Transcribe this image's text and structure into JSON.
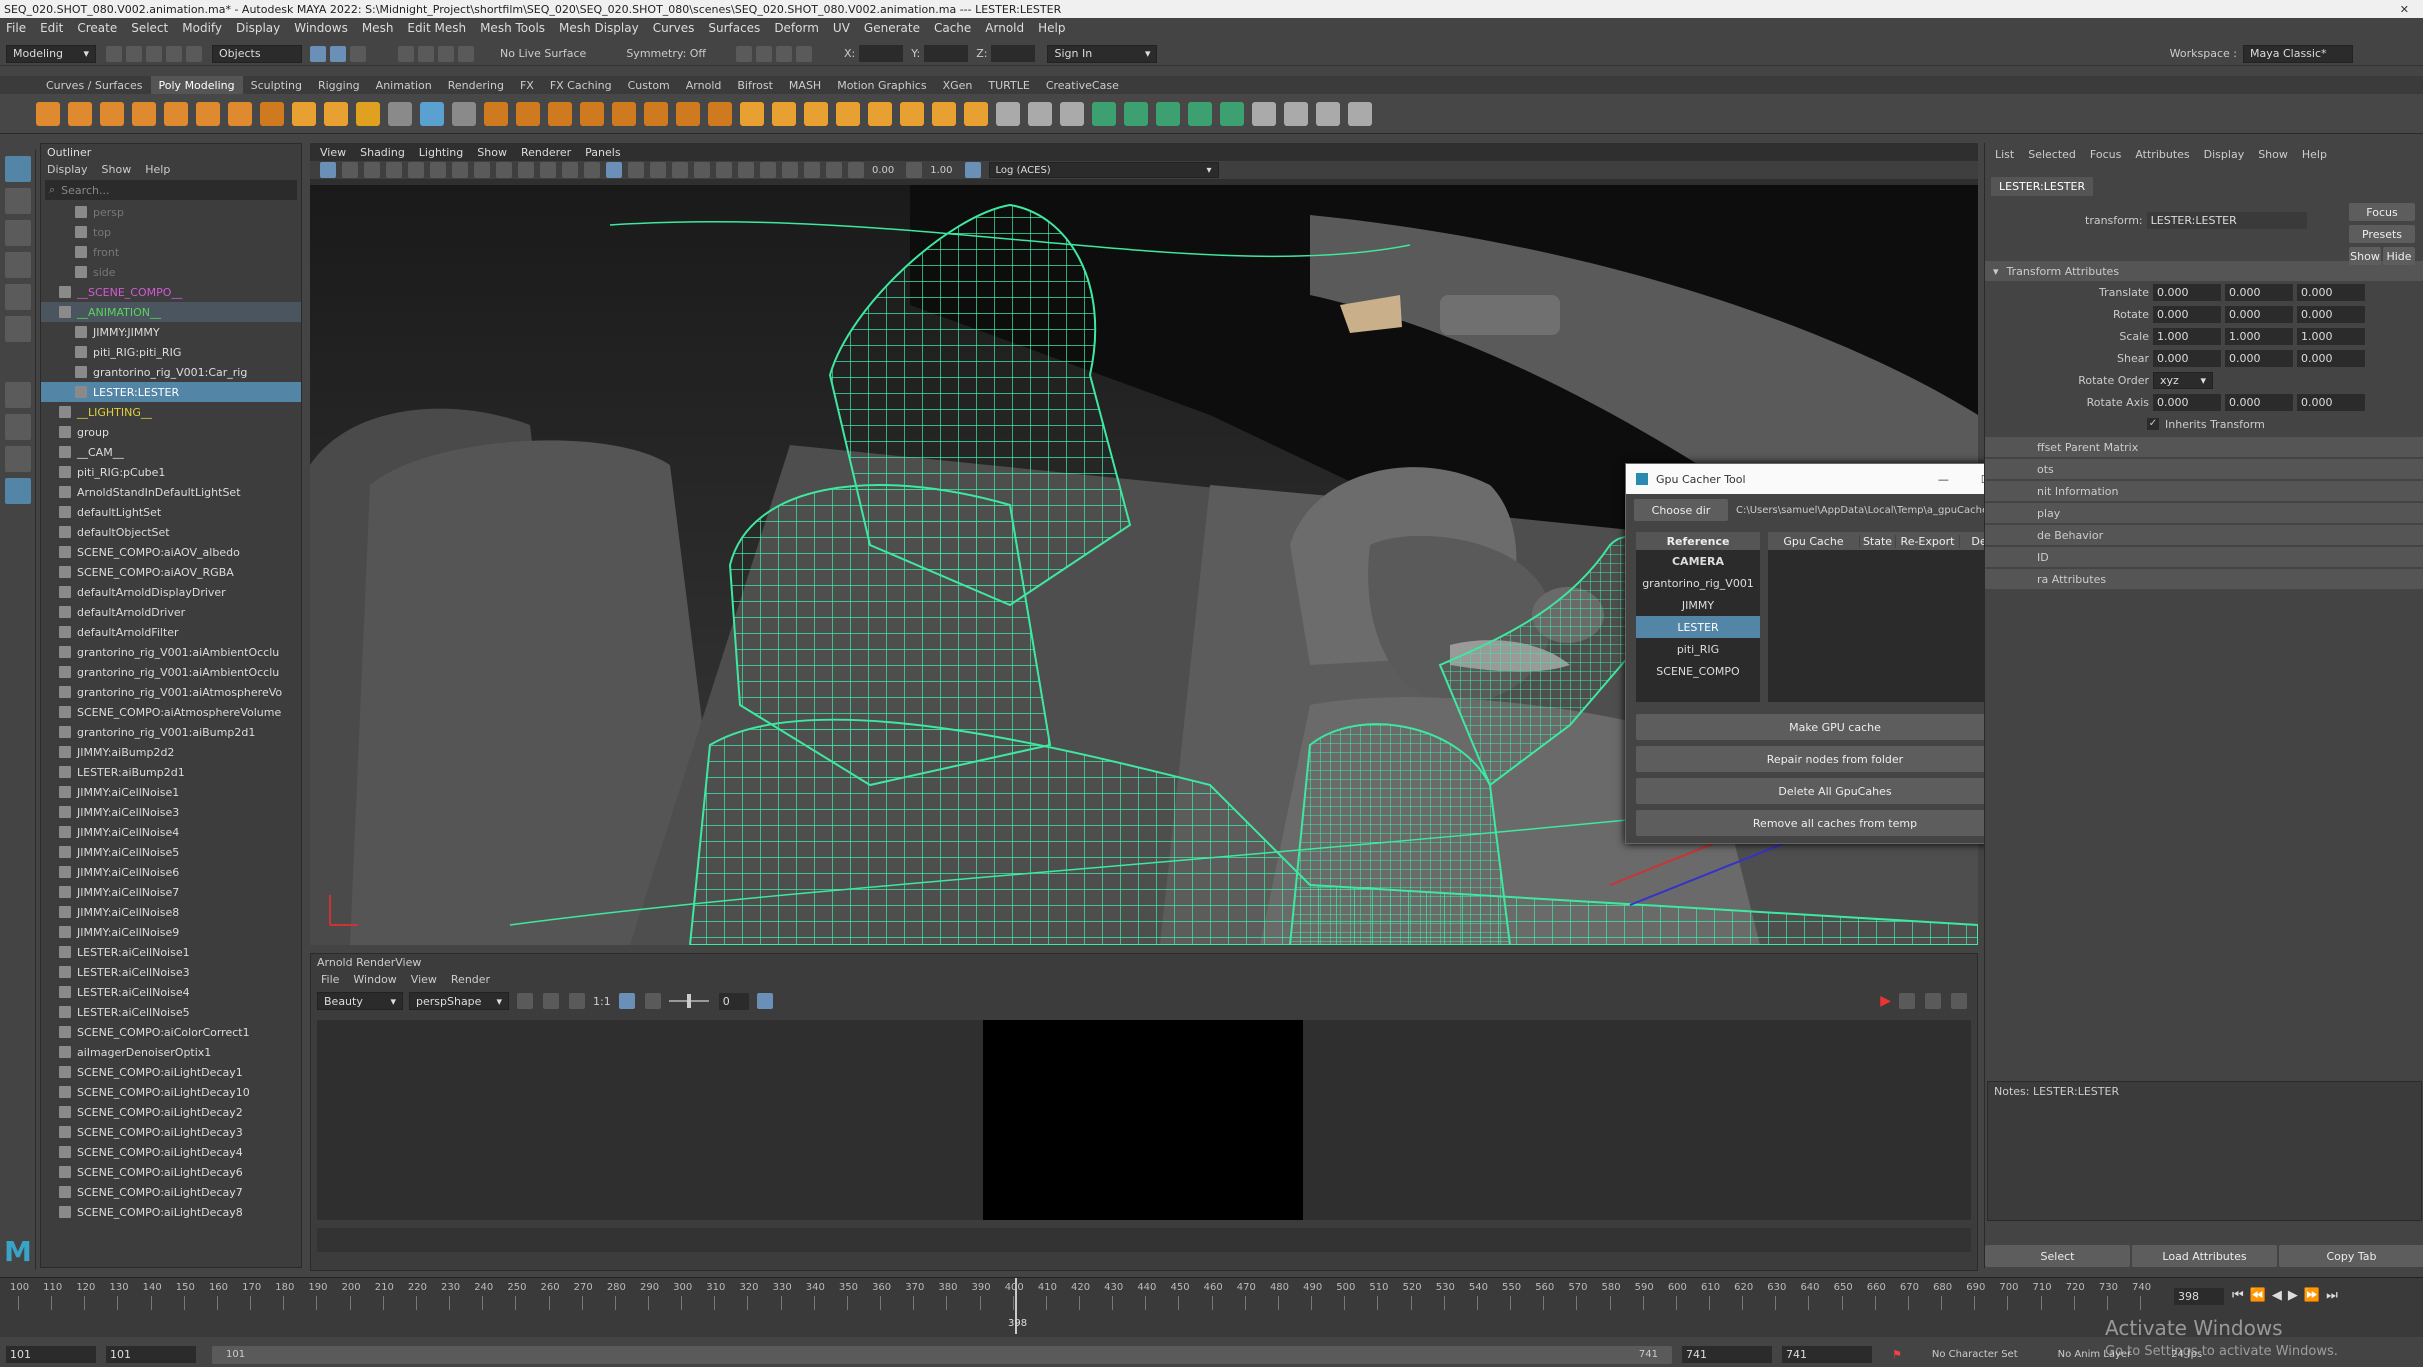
{
  "window": {
    "title": "SEQ_020.SHOT_080.V002.animation.ma* - Autodesk MAYA 2022: S:\\Midnight_Project\\shortfilm\\SEQ_020\\SEQ_020.SHOT_080\\scenes\\SEQ_020.SHOT_080.V002.animation.ma  ---  LESTER:LESTER"
  },
  "menu": [
    "File",
    "Edit",
    "Create",
    "Select",
    "Modify",
    "Display",
    "Windows",
    "Mesh",
    "Edit Mesh",
    "Mesh Tools",
    "Mesh Display",
    "Curves",
    "Surfaces",
    "Deform",
    "UV",
    "Generate",
    "Cache",
    "Arnold",
    "Help"
  ],
  "status": {
    "mode": "Modeling",
    "objects": "Objects",
    "live_surface": "No Live Surface",
    "symmetry": "Symmetry: Off",
    "x_label": "X:",
    "y_label": "Y:",
    "z_label": "Z:",
    "signin": "Sign In",
    "workspace_label": "Workspace :",
    "workspace": "Maya Classic*"
  },
  "shelf_tabs": [
    "Curves / Surfaces",
    "Poly Modeling",
    "Sculpting",
    "Rigging",
    "Animation",
    "Rendering",
    "FX",
    "FX Caching",
    "Custom",
    "Arnold",
    "Bifrost",
    "MASH",
    "Motion Graphics",
    "XGen",
    "TURTLE",
    "CreativeCase"
  ],
  "outliner": {
    "title": "Outliner",
    "menu": [
      "Display",
      "Show",
      "Help"
    ],
    "search_placeholder": "Search...",
    "items": [
      {
        "label": "persp",
        "color": "#777777",
        "indent": 1,
        "state": ""
      },
      {
        "label": "top",
        "color": "#777777",
        "indent": 1,
        "state": ""
      },
      {
        "label": "front",
        "color": "#777777",
        "indent": 1,
        "state": ""
      },
      {
        "label": "side",
        "color": "#777777",
        "indent": 1,
        "state": ""
      },
      {
        "label": "__SCENE_COMPO__",
        "color": "#d45ad4",
        "indent": 0,
        "state": ""
      },
      {
        "label": "__ANIMATION__",
        "color": "#5ad45a",
        "indent": 0,
        "state": "hl"
      },
      {
        "label": "JIMMY:JIMMY",
        "color": "#dddddd",
        "indent": 1,
        "state": ""
      },
      {
        "label": "piti_RIG:piti_RIG",
        "color": "#dddddd",
        "indent": 1,
        "state": ""
      },
      {
        "label": "grantorino_rig_V001:Car_rig",
        "color": "#dddddd",
        "indent": 1,
        "state": ""
      },
      {
        "label": "LESTER:LESTER",
        "color": "#ffffff",
        "indent": 1,
        "state": "sel"
      },
      {
        "label": "__LIGHTING__",
        "color": "#e0d040",
        "indent": 0,
        "state": ""
      },
      {
        "label": "group",
        "color": "#dddddd",
        "indent": 0,
        "state": ""
      },
      {
        "label": "__CAM__",
        "color": "#dddddd",
        "indent": 0,
        "state": ""
      },
      {
        "label": "piti_RIG:pCube1",
        "color": "#dddddd",
        "indent": 0,
        "state": ""
      },
      {
        "label": "ArnoldStandInDefaultLightSet",
        "color": "#dddddd",
        "indent": 0,
        "state": ""
      },
      {
        "label": "defaultLightSet",
        "color": "#dddddd",
        "indent": 0,
        "state": ""
      },
      {
        "label": "defaultObjectSet",
        "color": "#dddddd",
        "indent": 0,
        "state": ""
      },
      {
        "label": "SCENE_COMPO:aiAOV_albedo",
        "color": "#dddddd",
        "indent": 0,
        "state": ""
      },
      {
        "label": "SCENE_COMPO:aiAOV_RGBA",
        "color": "#dddddd",
        "indent": 0,
        "state": ""
      },
      {
        "label": "defaultArnoldDisplayDriver",
        "color": "#dddddd",
        "indent": 0,
        "state": ""
      },
      {
        "label": "defaultArnoldDriver",
        "color": "#dddddd",
        "indent": 0,
        "state": ""
      },
      {
        "label": "defaultArnoldFilter",
        "color": "#dddddd",
        "indent": 0,
        "state": ""
      },
      {
        "label": "grantorino_rig_V001:aiAmbientOcclu",
        "color": "#dddddd",
        "indent": 0,
        "state": ""
      },
      {
        "label": "grantorino_rig_V001:aiAmbientOcclu",
        "color": "#dddddd",
        "indent": 0,
        "state": ""
      },
      {
        "label": "grantorino_rig_V001:aiAtmosphereVo",
        "color": "#dddddd",
        "indent": 0,
        "state": ""
      },
      {
        "label": "SCENE_COMPO:aiAtmosphereVolume",
        "color": "#dddddd",
        "indent": 0,
        "state": ""
      },
      {
        "label": "grantorino_rig_V001:aiBump2d1",
        "color": "#dddddd",
        "indent": 0,
        "state": ""
      },
      {
        "label": "JIMMY:aiBump2d2",
        "color": "#dddddd",
        "indent": 0,
        "state": ""
      },
      {
        "label": "LESTER:aiBump2d1",
        "color": "#dddddd",
        "indent": 0,
        "state": ""
      },
      {
        "label": "JIMMY:aiCellNoise1",
        "color": "#dddddd",
        "indent": 0,
        "state": ""
      },
      {
        "label": "JIMMY:aiCellNoise3",
        "color": "#dddddd",
        "indent": 0,
        "state": ""
      },
      {
        "label": "JIMMY:aiCellNoise4",
        "color": "#dddddd",
        "indent": 0,
        "state": ""
      },
      {
        "label": "JIMMY:aiCellNoise5",
        "color": "#dddddd",
        "indent": 0,
        "state": ""
      },
      {
        "label": "JIMMY:aiCellNoise6",
        "color": "#dddddd",
        "indent": 0,
        "state": ""
      },
      {
        "label": "JIMMY:aiCellNoise7",
        "color": "#dddddd",
        "indent": 0,
        "state": ""
      },
      {
        "label": "JIMMY:aiCellNoise8",
        "color": "#dddddd",
        "indent": 0,
        "state": ""
      },
      {
        "label": "JIMMY:aiCellNoise9",
        "color": "#dddddd",
        "indent": 0,
        "state": ""
      },
      {
        "label": "LESTER:aiCellNoise1",
        "color": "#dddddd",
        "indent": 0,
        "state": ""
      },
      {
        "label": "LESTER:aiCellNoise3",
        "color": "#dddddd",
        "indent": 0,
        "state": ""
      },
      {
        "label": "LESTER:aiCellNoise4",
        "color": "#dddddd",
        "indent": 0,
        "state": ""
      },
      {
        "label": "LESTER:aiCellNoise5",
        "color": "#dddddd",
        "indent": 0,
        "state": ""
      },
      {
        "label": "SCENE_COMPO:aiColorCorrect1",
        "color": "#dddddd",
        "indent": 0,
        "state": ""
      },
      {
        "label": "aiImagerDenoiserOptix1",
        "color": "#dddddd",
        "indent": 0,
        "state": ""
      },
      {
        "label": "SCENE_COMPO:aiLightDecay1",
        "color": "#dddddd",
        "indent": 0,
        "state": ""
      },
      {
        "label": "SCENE_COMPO:aiLightDecay10",
        "color": "#dddddd",
        "indent": 0,
        "state": ""
      },
      {
        "label": "SCENE_COMPO:aiLightDecay2",
        "color": "#dddddd",
        "indent": 0,
        "state": ""
      },
      {
        "label": "SCENE_COMPO:aiLightDecay3",
        "color": "#dddddd",
        "indent": 0,
        "state": ""
      },
      {
        "label": "SCENE_COMPO:aiLightDecay4",
        "color": "#dddddd",
        "indent": 0,
        "state": ""
      },
      {
        "label": "SCENE_COMPO:aiLightDecay6",
        "color": "#dddddd",
        "indent": 0,
        "state": ""
      },
      {
        "label": "SCENE_COMPO:aiLightDecay7",
        "color": "#dddddd",
        "indent": 0,
        "state": ""
      },
      {
        "label": "SCENE_COMPO:aiLightDecay8",
        "color": "#dddddd",
        "indent": 0,
        "state": ""
      }
    ]
  },
  "viewport": {
    "menu": [
      "View",
      "Shading",
      "Lighting",
      "Show",
      "Renderer",
      "Panels"
    ],
    "exposure": "0.00",
    "gamma": "1.00",
    "colorspace": "Log (ACES)"
  },
  "gpu_tool": {
    "title": "Gpu Cacher Tool",
    "choose_dir": "Choose dir",
    "path": "C:\\Users\\samuel\\AppData\\Local\\Temp\\a_gpuCacherTemp",
    "ref_header": "Reference",
    "refs": [
      "CAMERA",
      "grantorino_rig_V001",
      "JIMMY",
      "LESTER",
      "piti_RIG",
      "SCENE_COMPO"
    ],
    "cols": [
      "Gpu Cache",
      "State",
      "Re-Export",
      "Delete"
    ],
    "buttons": [
      "Make GPU cache",
      "Repair nodes from folder",
      "Delete All GpuCahes",
      "Remove all caches from temp"
    ]
  },
  "attr": {
    "menu": [
      "List",
      "Selected",
      "Focus",
      "Attributes",
      "Display",
      "Show",
      "Help"
    ],
    "tab": "LESTER:LESTER",
    "transform_label": "transform:",
    "transform_value": "LESTER:LESTER",
    "focus": "Focus",
    "presets": "Presets",
    "show": "Show",
    "hide": "Hide",
    "section": "Transform Attributes",
    "rows": [
      {
        "label": "Translate",
        "v": [
          "0.000",
          "0.000",
          "0.000"
        ]
      },
      {
        "label": "Rotate",
        "v": [
          "0.000",
          "0.000",
          "0.000"
        ]
      },
      {
        "label": "Scale",
        "v": [
          "1.000",
          "1.000",
          "1.000"
        ]
      },
      {
        "label": "Shear",
        "v": [
          "0.000",
          "0.000",
          "0.000"
        ]
      }
    ],
    "rotate_order_label": "Rotate Order",
    "rotate_order": "xyz",
    "rotate_axis_label": "Rotate Axis",
    "rotate_axis": [
      "0.000",
      "0.000",
      "0.000"
    ],
    "inherits": "Inherits Transform",
    "collapsed": [
      "ffset Parent Matrix",
      "ots",
      "nit Information",
      "play",
      "de Behavior",
      "ID",
      "ra Attributes"
    ],
    "notes": "Notes:  LESTER:LESTER",
    "bottom_buttons": [
      "Select",
      "Load Attributes",
      "Copy Tab"
    ]
  },
  "renderview": {
    "title": "Arnold RenderView",
    "menu": [
      "File",
      "Window",
      "View",
      "Render"
    ],
    "aov": "Beauty",
    "camera": "perspShape",
    "ratio": "1:1",
    "exposure": "0"
  },
  "timeline": {
    "ticks": [
      "100",
      "110",
      "120",
      "130",
      "140",
      "150",
      "160",
      "170",
      "180",
      "190",
      "200",
      "210",
      "220",
      "230",
      "240",
      "250",
      "260",
      "270",
      "280",
      "290",
      "300",
      "310",
      "320",
      "330",
      "340",
      "350",
      "360",
      "370",
      "380",
      "390",
      "400",
      "410",
      "420",
      "430",
      "440",
      "450",
      "460",
      "470",
      "480",
      "490",
      "500",
      "510",
      "520",
      "530",
      "540",
      "550",
      "560",
      "570",
      "580",
      "590",
      "600",
      "610",
      "620",
      "630",
      "640",
      "650",
      "660",
      "670",
      "680",
      "690",
      "700",
      "710",
      "720",
      "730",
      "740"
    ],
    "current": "398",
    "current_field": "398"
  },
  "range": {
    "start": "101",
    "start2": "101",
    "inner_start": "101",
    "inner_end": "741",
    "end": "741",
    "end2": "741",
    "character_set": "No Character Set",
    "anim_layer": "No Anim Layer",
    "fps": "24 fps"
  },
  "watermark": {
    "line1": "Activate Windows",
    "line2": "Go to Settings to activate Windows."
  }
}
